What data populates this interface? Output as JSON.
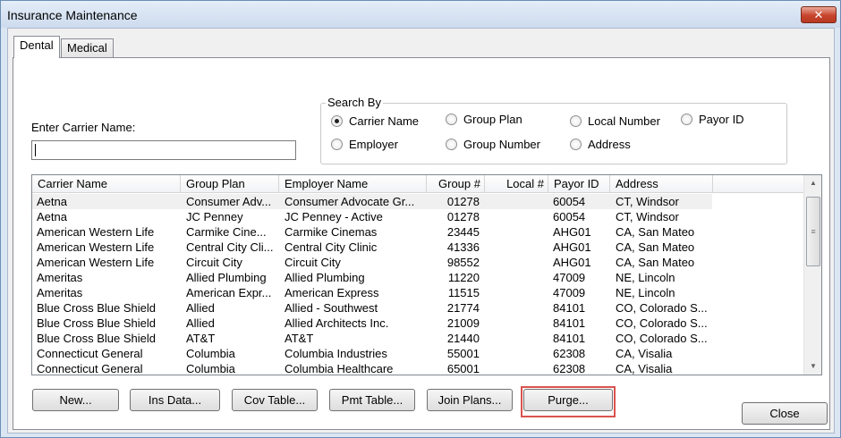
{
  "window": {
    "title": "Insurance Maintenance",
    "close_glyph": "✕"
  },
  "tabs": [
    {
      "label": "Dental",
      "active": true
    },
    {
      "label": "Medical",
      "active": false
    }
  ],
  "carrier_search": {
    "label": "Enter Carrier Name:",
    "value": ""
  },
  "search_by": {
    "legend": "Search By",
    "options": [
      {
        "label": "Carrier Name",
        "checked": true
      },
      {
        "label": "Group Plan",
        "checked": false
      },
      {
        "label": "Local Number",
        "checked": false
      },
      {
        "label": "Payor ID",
        "checked": false
      },
      {
        "label": "Employer",
        "checked": false
      },
      {
        "label": "Group Number",
        "checked": false
      },
      {
        "label": "Address",
        "checked": false
      }
    ]
  },
  "table": {
    "columns": [
      "Carrier Name",
      "Group Plan",
      "Employer Name",
      "Group #",
      "Local #",
      "Payor ID",
      "Address"
    ],
    "rows": [
      [
        "Aetna",
        "Consumer Adv...",
        "Consumer Advocate Gr...",
        "01278",
        "",
        "60054",
        "CT, Windsor"
      ],
      [
        "Aetna",
        "JC Penney",
        "JC Penney - Active",
        "01278",
        "",
        "60054",
        "CT, Windsor"
      ],
      [
        "American Western Life",
        "Carmike Cine...",
        "Carmike Cinemas",
        "23445",
        "",
        "AHG01",
        "CA, San Mateo"
      ],
      [
        "American Western Life",
        "Central City Cli...",
        "Central City Clinic",
        "41336",
        "",
        "AHG01",
        "CA, San Mateo"
      ],
      [
        "American Western Life",
        "Circuit City",
        "Circuit City",
        "98552",
        "",
        "AHG01",
        "CA, San Mateo"
      ],
      [
        "Ameritas",
        "Allied Plumbing",
        "Allied Plumbing",
        "11220",
        "",
        "47009",
        "NE, Lincoln"
      ],
      [
        "Ameritas",
        "American Expr...",
        "American Express",
        "11515",
        "",
        "47009",
        "NE, Lincoln"
      ],
      [
        "Blue Cross Blue Shield",
        "Allied",
        "Allied - Southwest",
        "21774",
        "",
        "84101",
        "CO, Colorado S..."
      ],
      [
        "Blue Cross Blue Shield",
        "Allied",
        "Allied Architects Inc.",
        "21009",
        "",
        "84101",
        "CO, Colorado S..."
      ],
      [
        "Blue Cross Blue Shield",
        "AT&T",
        "AT&T",
        "21440",
        "",
        "84101",
        "CO, Colorado S..."
      ],
      [
        "Connecticut General",
        "Columbia",
        "Columbia Industries",
        "55001",
        "",
        "62308",
        "CA, Visalia"
      ],
      [
        "Connecticut General",
        "Columbia",
        "Columbia Healthcare",
        "65001",
        "",
        "62308",
        "CA, Visalia"
      ]
    ]
  },
  "scrollbar": {
    "up_glyph": "▲",
    "down_glyph": "▼",
    "thumb_glyph": "≡"
  },
  "buttons": {
    "new": "New...",
    "ins_data": "Ins Data...",
    "cov_table": "Cov Table...",
    "pmt_table": "Pmt Table...",
    "join_plans": "Join Plans...",
    "purge": "Purge...",
    "close": "Close"
  }
}
